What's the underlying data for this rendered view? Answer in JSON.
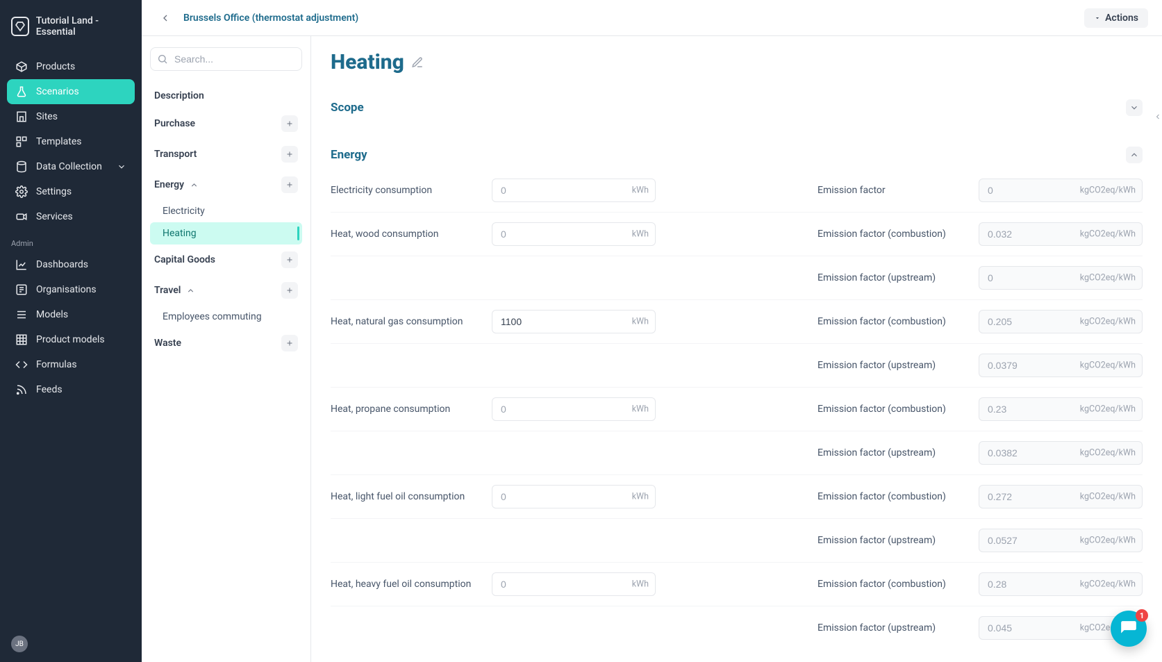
{
  "workspace": {
    "name": "Tutorial Land - Essential"
  },
  "sidebar": {
    "items": [
      {
        "label": "Products"
      },
      {
        "label": "Scenarios"
      },
      {
        "label": "Sites"
      },
      {
        "label": "Templates"
      },
      {
        "label": "Data Collection"
      },
      {
        "label": "Settings"
      },
      {
        "label": "Services"
      }
    ],
    "admin_label": "Admin",
    "admin_items": [
      {
        "label": "Dashboards"
      },
      {
        "label": "Organisations"
      },
      {
        "label": "Models"
      },
      {
        "label": "Product models"
      },
      {
        "label": "Formulas"
      },
      {
        "label": "Feeds"
      }
    ],
    "user_initials": "JB"
  },
  "topbar": {
    "breadcrumb": "Brussels Office (thermostat adjustment)",
    "actions_label": "Actions"
  },
  "left_panel": {
    "search_placeholder": "Search...",
    "items": [
      {
        "label": "Description"
      },
      {
        "label": "Purchase"
      },
      {
        "label": "Transport"
      },
      {
        "label": "Energy"
      },
      {
        "label": "Capital Goods"
      },
      {
        "label": "Travel"
      },
      {
        "label": "Waste"
      }
    ],
    "energy_sub": [
      {
        "label": "Electricity"
      },
      {
        "label": "Heating"
      }
    ],
    "travel_sub": [
      {
        "label": "Employees commuting"
      }
    ]
  },
  "page": {
    "title": "Heating",
    "sections": {
      "scope": {
        "title": "Scope"
      },
      "energy": {
        "title": "Energy"
      }
    }
  },
  "units": {
    "kwh": "kWh",
    "ef": "kgCO2eq/kWh"
  },
  "rows": [
    {
      "left_label": "Electricity consumption",
      "left_value": "",
      "left_placeholder": "0",
      "right_label": "Emission factor",
      "right_value": "",
      "right_placeholder": "0"
    },
    {
      "left_label": "Heat, wood consumption",
      "left_value": "",
      "left_placeholder": "0",
      "right_label": "Emission factor (combustion)",
      "right_value": "",
      "right_placeholder": "0.032"
    },
    {
      "left_label": "",
      "left_value": "",
      "left_placeholder": "",
      "hide_left": true,
      "right_label": "Emission factor (upstream)",
      "right_value": "",
      "right_placeholder": "0"
    },
    {
      "left_label": "Heat, natural gas consumption",
      "left_value": "1100",
      "left_placeholder": "",
      "right_label": "Emission factor (combustion)",
      "right_value": "",
      "right_placeholder": "0.205"
    },
    {
      "left_label": "",
      "left_value": "",
      "left_placeholder": "",
      "hide_left": true,
      "right_label": "Emission factor (upstream)",
      "right_value": "",
      "right_placeholder": "0.0379"
    },
    {
      "left_label": "Heat, propane consumption",
      "left_value": "",
      "left_placeholder": "0",
      "right_label": "Emission factor (combustion)",
      "right_value": "",
      "right_placeholder": "0.23"
    },
    {
      "left_label": "",
      "left_value": "",
      "left_placeholder": "",
      "hide_left": true,
      "right_label": "Emission factor (upstream)",
      "right_value": "",
      "right_placeholder": "0.0382"
    },
    {
      "left_label": "Heat, light fuel oil consumption",
      "left_value": "",
      "left_placeholder": "0",
      "right_label": "Emission factor (combustion)",
      "right_value": "",
      "right_placeholder": "0.272"
    },
    {
      "left_label": "",
      "left_value": "",
      "left_placeholder": "",
      "hide_left": true,
      "right_label": "Emission factor (upstream)",
      "right_value": "",
      "right_placeholder": "0.0527"
    },
    {
      "left_label": "Heat, heavy fuel oil consumption",
      "left_value": "",
      "left_placeholder": "0",
      "right_label": "Emission factor (combustion)",
      "right_value": "",
      "right_placeholder": "0.28"
    },
    {
      "left_label": "",
      "left_value": "",
      "left_placeholder": "",
      "hide_left": true,
      "right_label": "Emission factor (upstream)",
      "right_value": "",
      "right_placeholder": "0.045"
    }
  ],
  "chat": {
    "badge": "1"
  }
}
